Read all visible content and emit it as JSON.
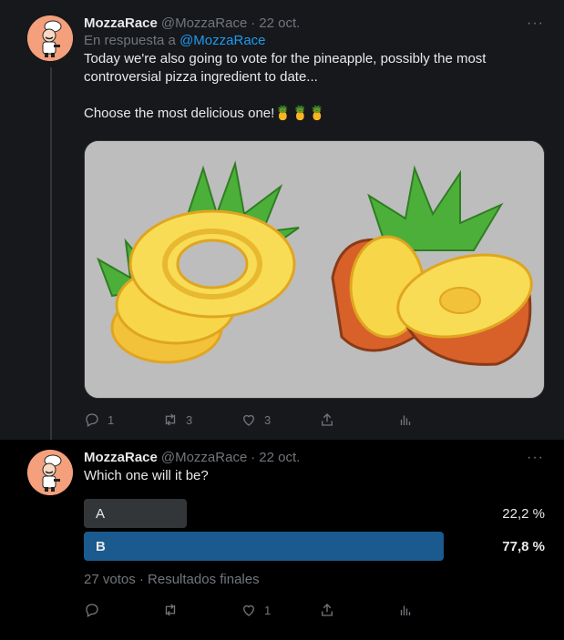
{
  "tweets": [
    {
      "name": "MozzaRace",
      "handle": "@MozzaRace",
      "separator": "·",
      "date": "22 oct.",
      "reply_prefix": "En respuesta a",
      "reply_handle": "@MozzaRace",
      "text": "Today we're also going to vote for the pineapple, possibly the most controversial pizza ingredient to date...\n\nChoose the most delicious one!🍍🍍🍍",
      "more": "···",
      "media_colors": {
        "bg": "#bdbdbd",
        "leaf": "#4caf3a",
        "ring": "#f7d64a",
        "shell": "#d8612a"
      },
      "counts": {
        "reply": "1",
        "retweet": "3",
        "like": "3",
        "share": "",
        "analytics": ""
      }
    },
    {
      "name": "MozzaRace",
      "handle": "@MozzaRace",
      "separator": "·",
      "date": "22 oct.",
      "text": "Which one will it be?",
      "more": "···",
      "poll": {
        "options": [
          {
            "label": "A",
            "percent_text": "22,2 %",
            "percent": 22.2,
            "color": "#333639"
          },
          {
            "label": "B",
            "percent_text": "77,8 %",
            "percent": 77.8,
            "color": "#1a5a8e"
          }
        ],
        "meta": "27 votos · Resultados finales"
      },
      "counts": {
        "reply": "",
        "retweet": "",
        "like": "1",
        "share": "",
        "analytics": ""
      }
    }
  ],
  "colors": {
    "accent": "#1d9bf0",
    "secondary_text": "#71767b",
    "avatar_bg": "#f4a07c"
  }
}
